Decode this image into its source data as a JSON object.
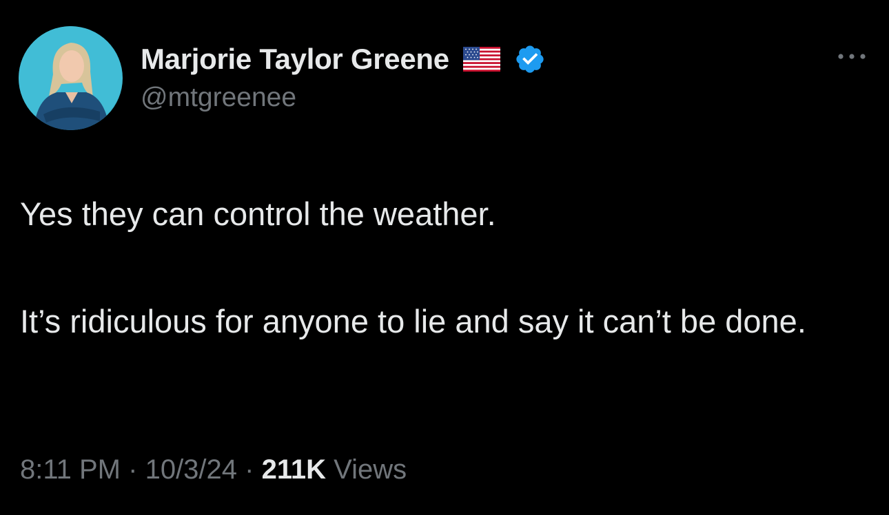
{
  "author": {
    "display_name": "Marjorie Taylor Greene",
    "handle": "@mtgreenee",
    "flag_icon": "us-flag-icon",
    "verified_icon": "verified-badge-icon",
    "verified_color": "#1d9bf0",
    "avatar_background": "#3bb6cf"
  },
  "menu": {
    "icon": "more-options-icon"
  },
  "tweet": {
    "paragraphs": [
      "Yes they can control the weather.",
      "It’s ridiculous for anyone to lie and say it can’t be done."
    ]
  },
  "meta": {
    "time": "8:11 PM",
    "separator": "·",
    "date": "10/3/24",
    "views_count": "211K",
    "views_label": "Views"
  },
  "colors": {
    "background": "#000000",
    "primary_text": "#e7e9ea",
    "secondary_text": "#71767b"
  }
}
